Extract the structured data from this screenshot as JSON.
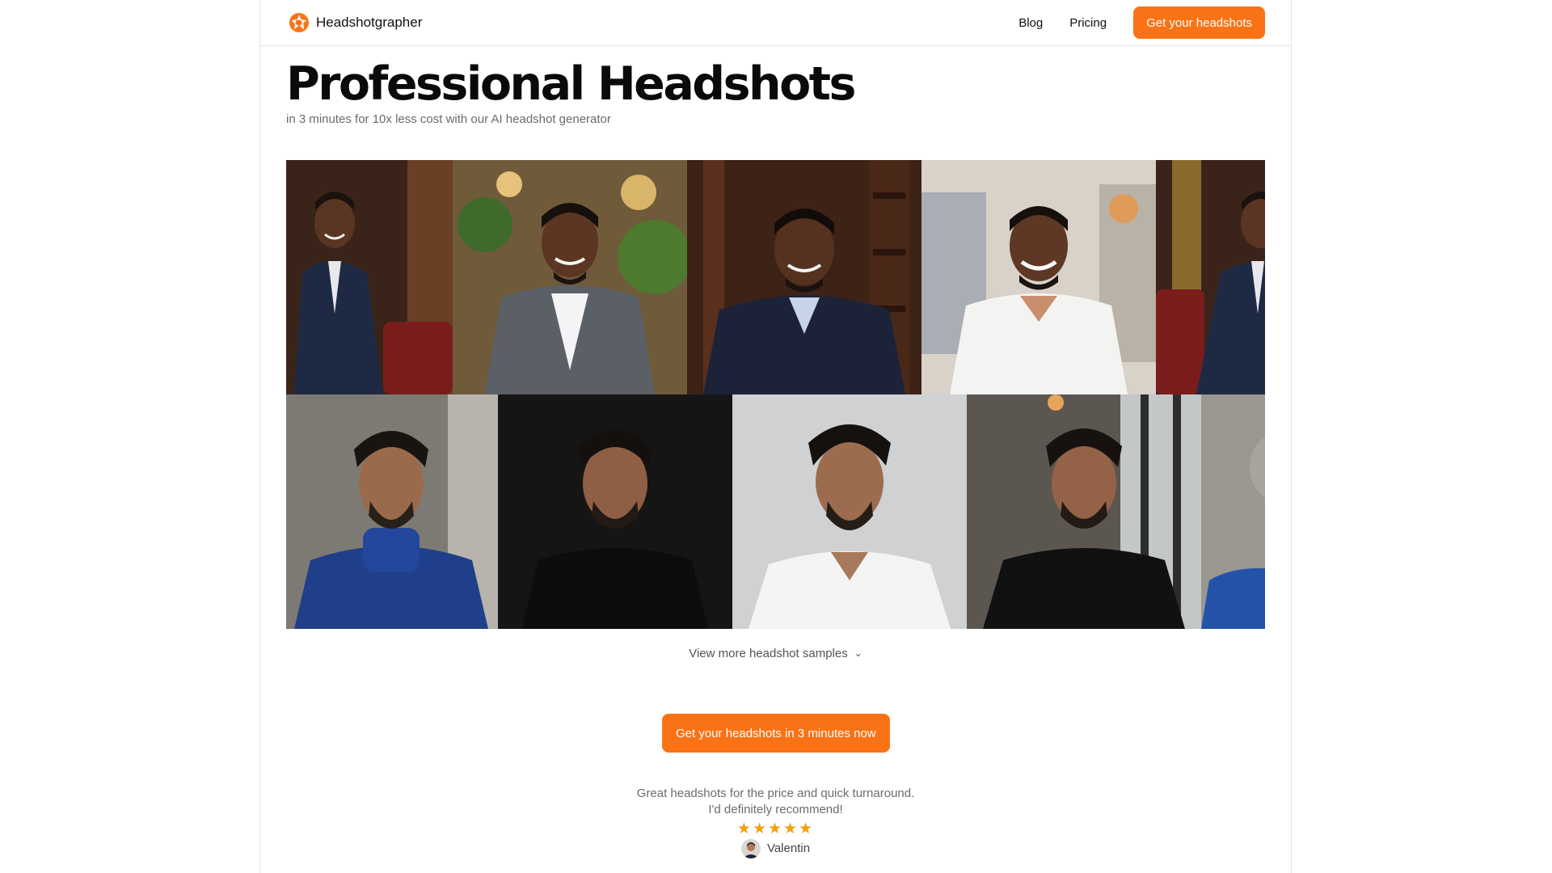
{
  "nav": {
    "brand": "Headshotgrapher",
    "links": [
      "Blog",
      "Pricing"
    ],
    "cta": "Get your headshots"
  },
  "hero": {
    "title": "Professional Headshots",
    "subtitle": "in 3 minutes for 10x less cost with our AI headshot generator"
  },
  "gallery": {
    "rows": [
      [
        {
          "outfit": "navy suit, red leather chair"
        },
        {
          "outfit": "grey blazer, plants"
        },
        {
          "outfit": "navy sweater, bookshelf"
        },
        {
          "outfit": "white shirt, office"
        },
        {
          "outfit": "navy suit, red leather chair"
        }
      ],
      [
        {
          "outfit": "blue turtleneck"
        },
        {
          "outfit": "black t-shirt, dark backdrop"
        },
        {
          "outfit": "white shirt, grey backdrop"
        },
        {
          "outfit": "black t-shirt, window"
        },
        {
          "outfit": "blue turtleneck"
        }
      ]
    ]
  },
  "more_samples": "View more headshot samples",
  "cta_main": "Get your headshots in 3 minutes now",
  "testimonial": {
    "line1": "Great headshots for the price and quick turnaround.",
    "line2": "I'd definitely recommend!",
    "stars": "★★★★★",
    "rating": 5,
    "author": "Valentin"
  },
  "colors": {
    "accent": "#f97316",
    "star": "#f59e0b"
  },
  "icons": {
    "logo": "aperture-icon",
    "more": "chevron-down-icon"
  }
}
